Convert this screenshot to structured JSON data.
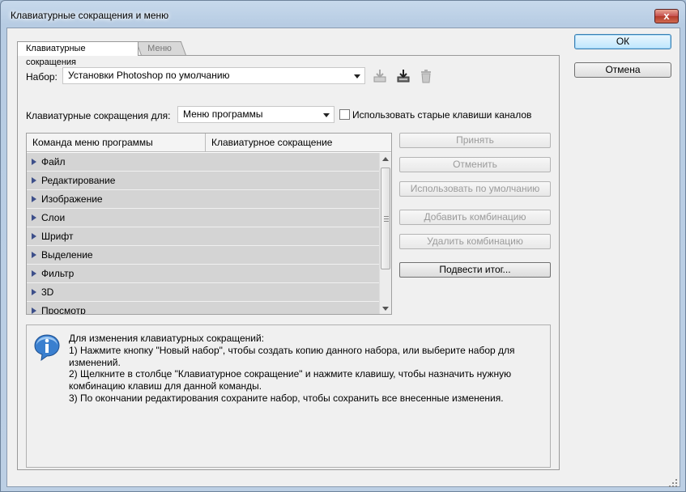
{
  "window": {
    "title": "Клавиатурные сокращения и меню",
    "close_glyph": "x"
  },
  "tabs": [
    {
      "label": "Клавиатурные сокращения"
    },
    {
      "label": "Меню"
    }
  ],
  "set_row": {
    "label": "Набор:",
    "value": "Установки Photoshop по умолчанию",
    "icons": [
      "save-set-icon",
      "save-as-new-set-icon",
      "delete-set-icon"
    ]
  },
  "shortcuts_for": {
    "label": "Клавиатурные сокращения для:",
    "value": "Меню программы",
    "checkbox_label": "Использовать старые клавиши каналов",
    "checkbox_checked": false
  },
  "table": {
    "columns": [
      "Команда меню программы",
      "Клавиатурное сокращение"
    ],
    "rows": [
      "Файл",
      "Редактирование",
      "Изображение",
      "Слои",
      "Шрифт",
      "Выделение",
      "Фильтр",
      "3D",
      "Просмотр"
    ]
  },
  "side_buttons": {
    "accept": "Принять",
    "undo": "Отменить",
    "use_default": "Использовать по умолчанию",
    "add_shortcut": "Добавить комбинацию",
    "delete_shortcut": "Удалить комбинацию",
    "summarize": "Подвести итог..."
  },
  "dialog_buttons": {
    "ok": "ОК",
    "cancel": "Отмена"
  },
  "info": {
    "icon": "info-icon",
    "lines": [
      "Для изменения клавиатурных сокращений:",
      "1) Нажмите кнопку \"Новый набор\", чтобы создать копию данного набора, или выберите набор для изменений.",
      "2) Щелкните в столбце \"Клавиатурное сокращение\" и нажмите клавишу, чтобы назначить нужную комбинацию клавиш для данной команды.",
      "3) По окончании редактирования сохраните набор, чтобы сохранить все внесенные изменения."
    ]
  },
  "colors": {
    "title_bar": "#b9cde4",
    "row_bg": "#d4d4d4",
    "default_button": "#bee6fd",
    "close_button": "#c75050"
  }
}
